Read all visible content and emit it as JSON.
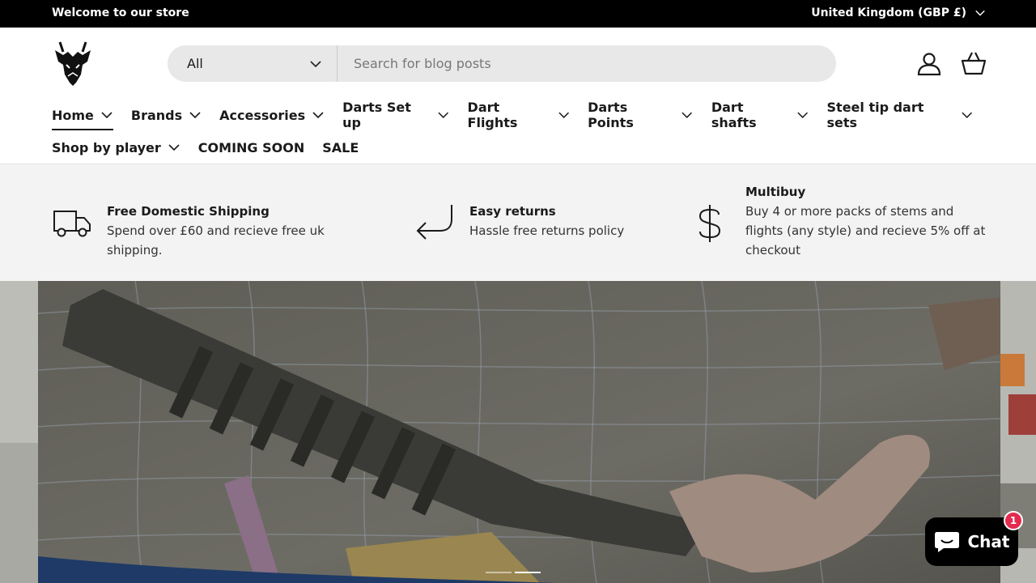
{
  "announcement": {
    "welcome": "Welcome to our store",
    "country": "United Kingdom (GBP £)"
  },
  "search": {
    "category": "All",
    "placeholder": "Search for blog posts"
  },
  "nav": {
    "row1": [
      {
        "label": "Home",
        "dropdown": true,
        "active": true
      },
      {
        "label": "Brands",
        "dropdown": true
      },
      {
        "label": "Accessories",
        "dropdown": true
      },
      {
        "label": "Darts Set up",
        "dropdown": true
      },
      {
        "label": "Dart Flights",
        "dropdown": true
      },
      {
        "label": "Darts Points",
        "dropdown": true
      },
      {
        "label": "Dart shafts",
        "dropdown": true
      },
      {
        "label": "Steel tip dart sets",
        "dropdown": true
      }
    ],
    "row2": [
      {
        "label": "Shop by player",
        "dropdown": true
      },
      {
        "label": "COMING SOON",
        "dropdown": false
      },
      {
        "label": "SALE",
        "dropdown": false
      }
    ]
  },
  "benefits": [
    {
      "icon": "truck-icon",
      "title": "Free Domestic Shipping",
      "text": "Spend over £60 and recieve free uk shipping."
    },
    {
      "icon": "return-arrow-icon",
      "title": "Easy returns",
      "text": "Hassle free returns policy"
    },
    {
      "icon": "dollar-icon",
      "title": "Multibuy",
      "text": "Buy 4 or more packs of stems and flights (any style) and recieve 5% off at checkout"
    }
  ],
  "hero": {
    "slide_count": 2,
    "active_slide": 2
  },
  "chat": {
    "label": "Chat",
    "badge": "1"
  },
  "colors": {
    "topbar": "#000000",
    "search_bg": "#e8e8e8",
    "benefits_bg": "#f3f3f3",
    "chat_badge": "#e32b4f"
  }
}
